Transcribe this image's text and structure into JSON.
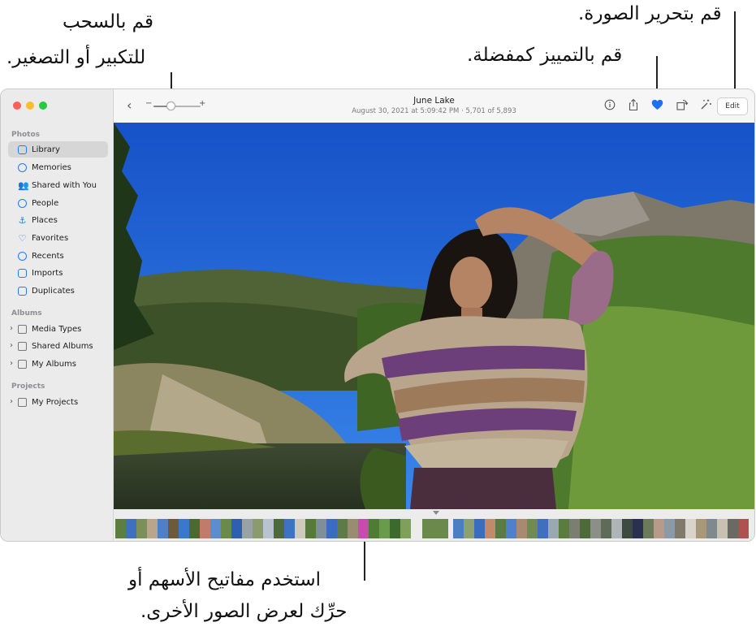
{
  "callouts": {
    "zoom_line1": "قم بالسحب",
    "zoom_line2": "للتكبير أو التصغير.",
    "edit": "قم بتحرير الصورة.",
    "favorite": "قم بالتمييز كمفضلة.",
    "nav_line1": "استخدم مفاتيح الأسهم أو",
    "nav_line2": "حرِّك لعرض الصور الأخرى."
  },
  "sidebar": {
    "sections": [
      {
        "label": "Photos",
        "items": [
          {
            "label": "Library",
            "icon": "library-icon",
            "selected": true
          },
          {
            "label": "Memories",
            "icon": "memories-icon"
          },
          {
            "label": "Shared with You",
            "icon": "shared-with-you-icon"
          },
          {
            "label": "People",
            "icon": "people-icon"
          },
          {
            "label": "Places",
            "icon": "places-icon"
          },
          {
            "label": "Favorites",
            "icon": "heart-icon"
          },
          {
            "label": "Recents",
            "icon": "clock-icon"
          },
          {
            "label": "Imports",
            "icon": "imports-icon"
          },
          {
            "label": "Duplicates",
            "icon": "duplicates-icon"
          }
        ]
      },
      {
        "label": "Albums",
        "items": [
          {
            "label": "Media Types",
            "icon": "folder-icon"
          },
          {
            "label": "Shared Albums",
            "icon": "shared-albums-icon"
          },
          {
            "label": "My Albums",
            "icon": "folder-icon"
          }
        ]
      },
      {
        "label": "Projects",
        "items": [
          {
            "label": "My Projects",
            "icon": "folder-icon"
          }
        ]
      }
    ]
  },
  "toolbar": {
    "title": "June Lake",
    "subtitle": "August 30, 2021 at 5:09:42 PM  ·  5,701 of 5,893",
    "zoom_minus": "−",
    "zoom_plus": "+",
    "zoom_level": 0.36,
    "edit_label": "Edit",
    "favorite_color": "#1f6ff2"
  },
  "colors": {
    "sky": "#1f63d6",
    "accent": "#1f7cf5"
  }
}
